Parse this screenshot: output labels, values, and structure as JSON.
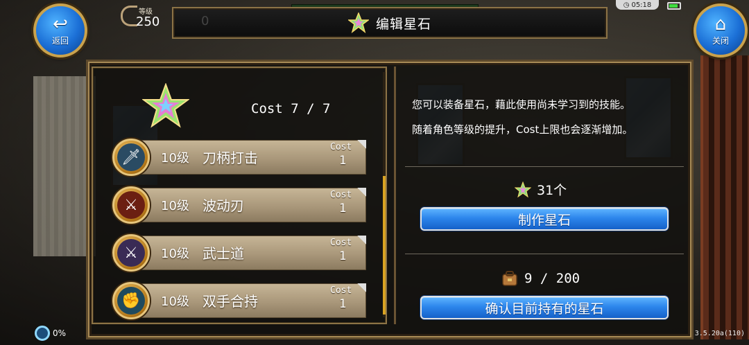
{
  "header": {
    "back_label": "返回",
    "close_label": "关闭",
    "level_label": "等级",
    "level_value": "250",
    "title": "编辑星石",
    "ghost_text": "0",
    "clock": "05:18"
  },
  "stone_panel": {
    "cost_total": "Cost 7 / 7",
    "skills": [
      {
        "level": "10级",
        "name": "刀柄打击",
        "cost_label": "Cost",
        "cost": "1",
        "icon": "sword-strike-icon",
        "glyph": "🗡"
      },
      {
        "level": "10级",
        "name": "波动刃",
        "cost_label": "Cost",
        "cost": "1",
        "icon": "wave-blade-icon",
        "glyph": "⚔"
      },
      {
        "level": "10级",
        "name": "武士道",
        "cost_label": "Cost",
        "cost": "1",
        "icon": "bushido-icon",
        "glyph": "⚔"
      },
      {
        "level": "10级",
        "name": "双手合持",
        "cost_label": "Cost",
        "cost": "1",
        "icon": "two-hand-grip-icon",
        "glyph": "✊"
      }
    ]
  },
  "info": {
    "line1": "您可以装备星石，藉此使用尚未学习到的技能。",
    "line2": "随着角色等级的提升，Cost上限也会逐渐增加。",
    "stone_count": "31个",
    "make_button": "制作星石",
    "bag_count": "9 / 200",
    "confirm_button": "确认目前持有的星石"
  },
  "footer": {
    "loading_percent": "0%",
    "version": "3.5.20a(110)"
  },
  "colors": {
    "gold_frame": "#8c7346",
    "button_blue": "#2d86ec",
    "skill_bar": "#a9977a",
    "scroll_thumb": "#d9a322"
  }
}
